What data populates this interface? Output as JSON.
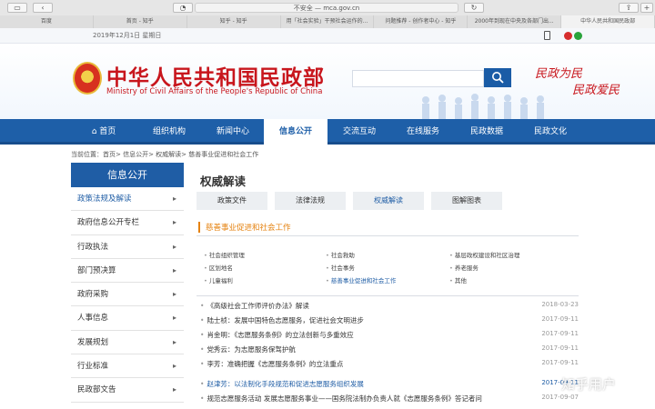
{
  "browser": {
    "address": "不安全 — mca.gov.cn",
    "tabs": [
      "百度",
      "首页 - 知乎",
      "知乎 - 知乎",
      "用「社会实验」干预社会运作的...",
      "问题推荐 - 创作者中心 - 知乎",
      "2000年到现在中央及各部门出...",
      "中华人民共和国民政部"
    ],
    "active_tab": 6
  },
  "topbar": {
    "date": "2019年12月1日  星期日"
  },
  "header": {
    "title_cn": "中华人民共和国民政部",
    "title_en": "Ministry of Civil Affairs of the People's Republic of China",
    "search_placeholder": "",
    "search_icon": "search-icon",
    "slogan1": "民政为民",
    "slogan2": "民政爱民"
  },
  "nav": {
    "items": [
      "首页",
      "组织机构",
      "新闻中心",
      "信息公开",
      "交流互动",
      "在线服务",
      "民政数据",
      "民政文化"
    ],
    "active": 3,
    "home_icon": "home-icon"
  },
  "breadcrumb": "当前位置：首页> 信息公开> 权威解读> 慈善事业促进和社会工作",
  "sidebar": {
    "title": "信息公开",
    "items": [
      "政策法规及解读",
      "政府信息公开专栏",
      "行政执法",
      "部门预决算",
      "政府采购",
      "人事信息",
      "发展规划",
      "行业标准",
      "民政部文告"
    ],
    "active": 0
  },
  "main": {
    "title": "权威解读",
    "subtabs": [
      "政策文件",
      "法律法规",
      "权威解读",
      "图解图表"
    ],
    "active_subtab": 2,
    "section_title": "慈善事业促进和社会工作",
    "categories": [
      "社会组织管理",
      "社会救助",
      "基层政权建设和社区治理",
      "区划地名",
      "社会事务",
      "养老服务",
      "儿童福利",
      "慈善事业促进和社会工作",
      "其他"
    ],
    "active_category": 7,
    "news": [
      {
        "title": "《高级社会工作师评价办法》解读",
        "date": "2018-03-23"
      },
      {
        "title": "陆士桢：发展中国特色志愿服务，促进社会文明进步",
        "date": "2017-09-11"
      },
      {
        "title": "肖金明：《志愿服务条例》的立法创新与多重效应",
        "date": "2017-09-11"
      },
      {
        "title": "党秀云：为志愿服务保驾护航",
        "date": "2017-09-11"
      },
      {
        "title": "李芳：准确把握《志愿服务条例》的立法重点",
        "date": "2017-09-11"
      },
      {
        "title": "赵津芳：以法制化手段规范和促进志愿服务组织发展",
        "date": "2017-09-11"
      },
      {
        "title": "规范志愿服务活动 发展志愿服务事业——国务院法制办负责人就《志愿服务条例》答记者问",
        "date": "2017-09-07"
      }
    ],
    "highlighted_news": 5
  },
  "watermark": "知乎用户",
  "colors": {
    "brand_red": "#c8161d",
    "nav_blue": "#1e5fa8",
    "accent_orange": "#e5820f"
  }
}
